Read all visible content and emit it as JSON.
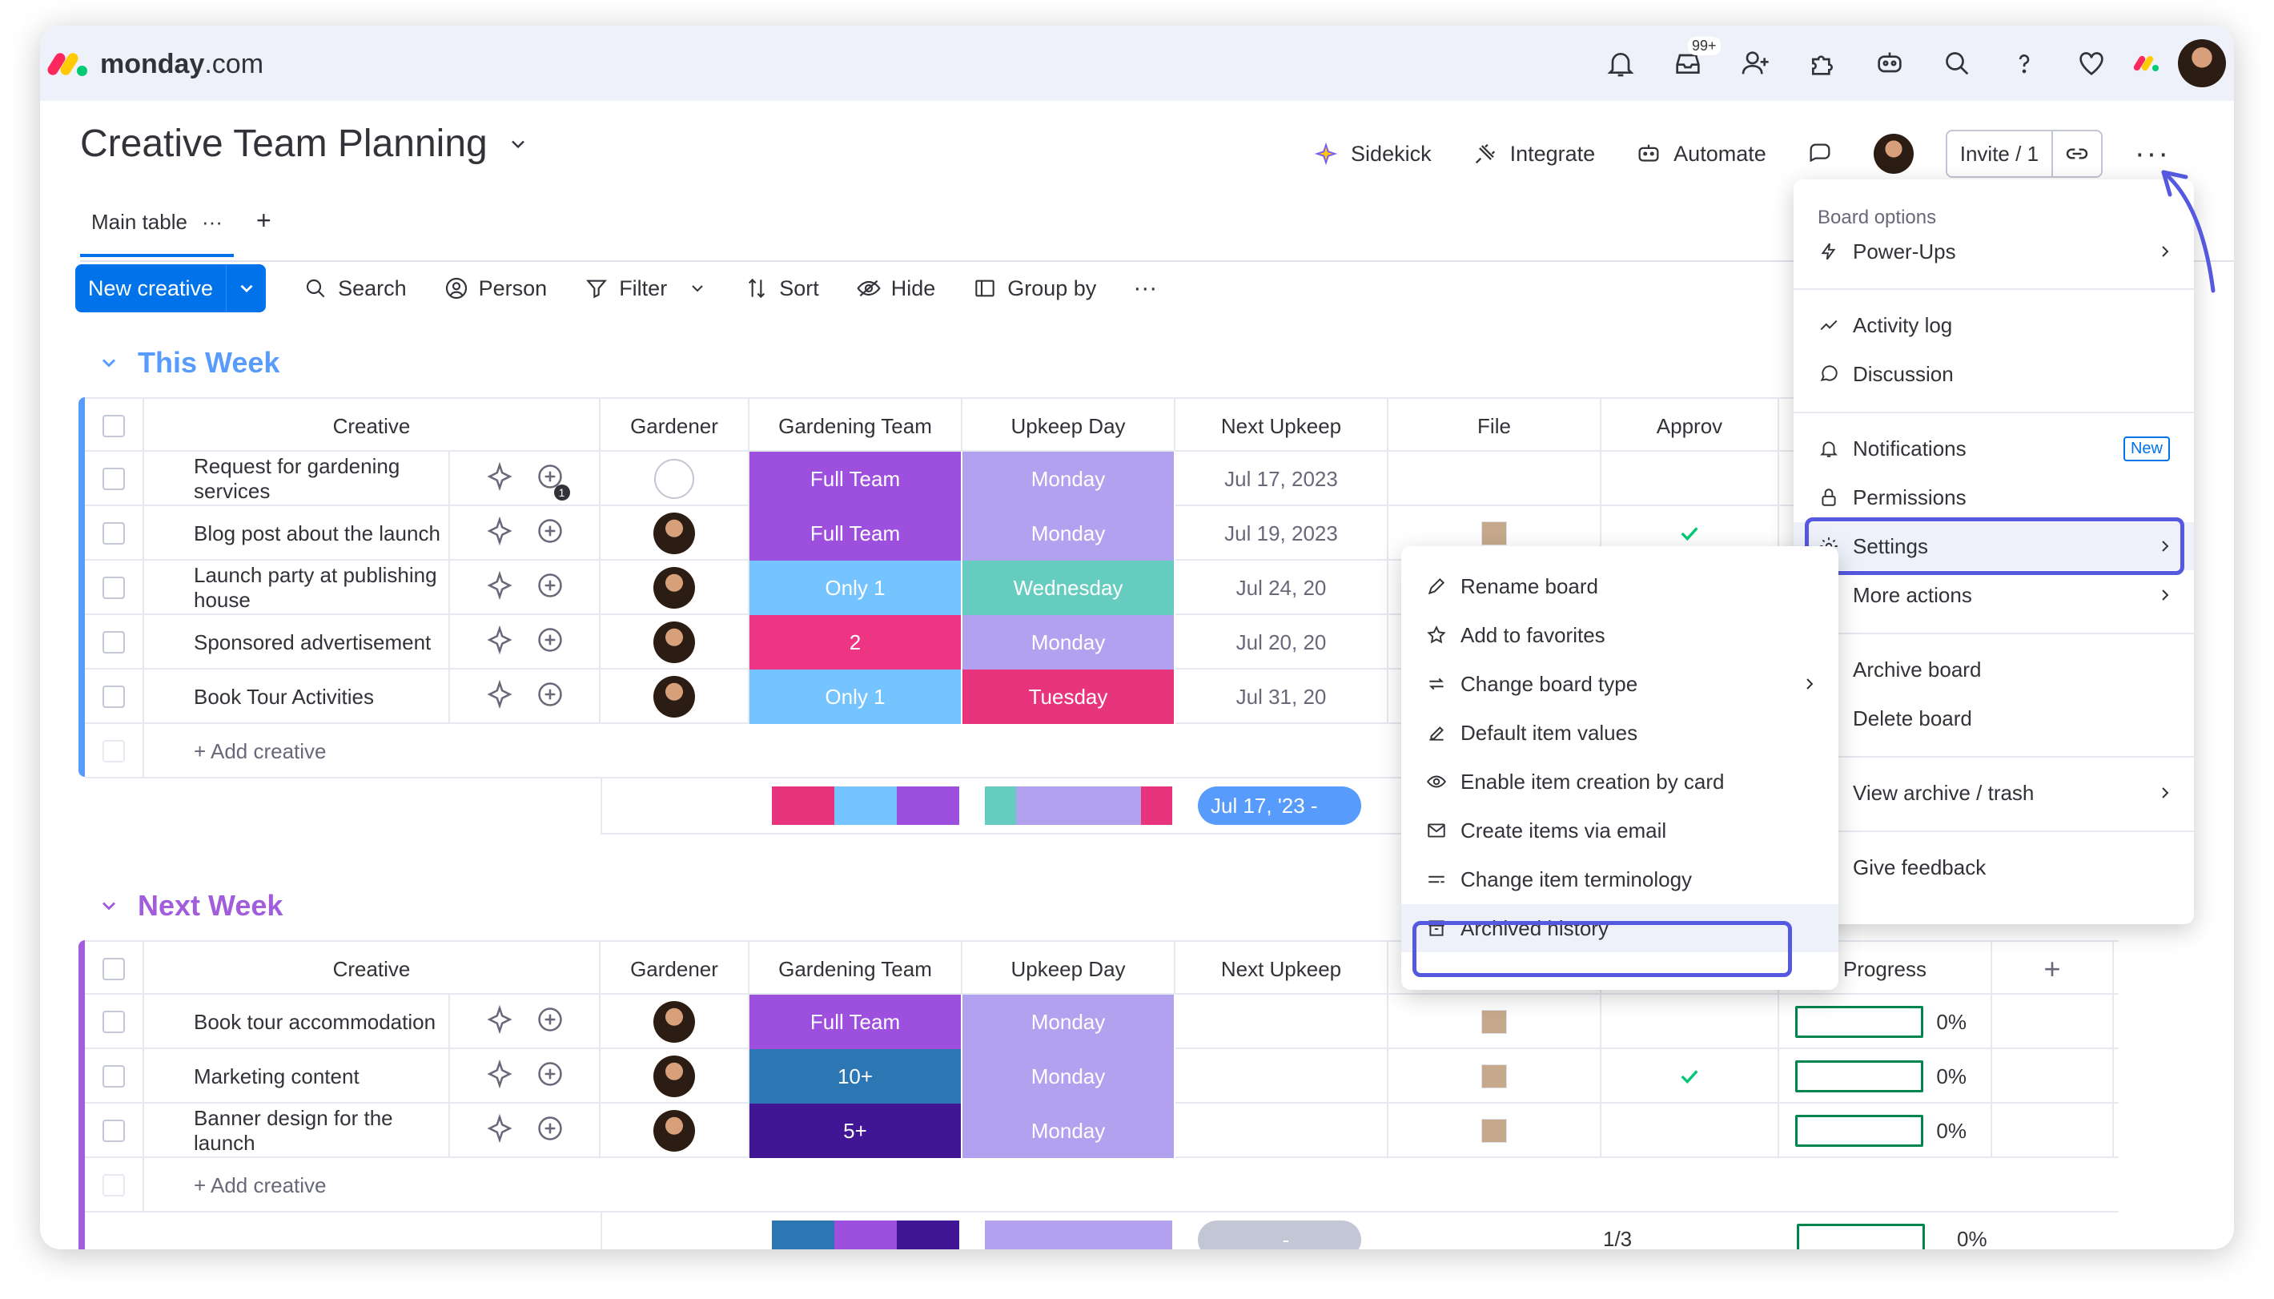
{
  "app": {
    "logo_brand": "monday",
    "logo_tld": ".com",
    "notif_badge": "99+"
  },
  "topbar_icons": [
    "bell-icon",
    "inbox-icon",
    "invite-user-icon",
    "apps-icon",
    "ai-bot-icon",
    "search-icon",
    "help-icon",
    "heart-icon"
  ],
  "board": {
    "title": "Creative Team Planning",
    "actions": {
      "sidekick": "Sidekick",
      "integrate": "Integrate",
      "automate": "Automate",
      "invite": "Invite / 1"
    }
  },
  "tabs": {
    "main": "Main table",
    "more": "···",
    "add": "+"
  },
  "toolbar": {
    "new": "New creative",
    "search": "Search",
    "person": "Person",
    "filter": "Filter",
    "sort": "Sort",
    "hide": "Hide",
    "group_by": "Group by",
    "more": "···"
  },
  "columns": {
    "creative": "Creative",
    "gardener": "Gardener",
    "team": "Gardening Team",
    "day": "Upkeep Day",
    "next": "Next Upkeep",
    "file": "File",
    "approved_cut": "Approv",
    "approved": "Approved?",
    "progress": "Progress",
    "add": "+"
  },
  "groups": [
    {
      "title": "This Week",
      "color": "#579bfc",
      "rows": [
        {
          "name": "Request for gardening services",
          "team": "Full Team",
          "team_color": "#9d50dd",
          "day": "Monday",
          "day_color": "#b2a1ee",
          "next": "Jul 17, 2023",
          "comment_badge": "1"
        },
        {
          "name": "Blog post about the launch",
          "team": "Full Team",
          "team_color": "#9d50dd",
          "day": "Monday",
          "day_color": "#b2a1ee",
          "next": "Jul 19, 2023"
        },
        {
          "name": "Launch party at publishing house",
          "team": "Only 1",
          "team_color": "#75c3ff",
          "day": "Wednesday",
          "day_color": "#66ccc0",
          "next": "Jul 24, 20"
        },
        {
          "name": "Sponsored advertisement",
          "team": "2",
          "team_color": "#ee3583",
          "day": "Monday",
          "day_color": "#b2a1ee",
          "next": "Jul 20, 20"
        },
        {
          "name": "Book Tour Activities",
          "team": "Only 1",
          "team_color": "#75c3ff",
          "day": "Tuesday",
          "day_color": "#e8347c",
          "next": "Jul 31, 20"
        }
      ],
      "add": "+ Add creative",
      "date_summary": "Jul 17, '23 -"
    },
    {
      "title": "Next Week",
      "color": "#a25ddc",
      "rows": [
        {
          "name": "Book tour accommodation",
          "team": "Full Team",
          "team_color": "#9d50dd",
          "day": "Monday",
          "day_color": "#b2a1ee",
          "progress": "0%"
        },
        {
          "name": "Marketing content",
          "team": "10+",
          "team_color": "#2b76b3",
          "day": "Monday",
          "day_color": "#b2a1ee",
          "progress": "0%"
        },
        {
          "name": "Banner design for the launch",
          "team": "5+",
          "team_color": "#401694",
          "day": "Monday",
          "day_color": "#b2a1ee",
          "progress": "0%"
        }
      ],
      "add": "+ Add creative",
      "approved_summary": "1/3",
      "progress_summary": "0%",
      "date_summary": "-"
    }
  ],
  "board_menu": {
    "header": "Board options",
    "items": [
      "Power-Ups",
      "Activity log",
      "Discussion",
      "Notifications",
      "Permissions",
      "Settings",
      "More actions",
      "Archive board",
      "Delete board",
      "View archive / trash",
      "Give feedback"
    ],
    "new_badge": "New"
  },
  "settings_menu": {
    "items": [
      "Rename board",
      "Add to favorites",
      "Change board type",
      "Default item values",
      "Enable item creation by card",
      "Create items via email",
      "Change item terminology",
      "Archived history"
    ]
  }
}
